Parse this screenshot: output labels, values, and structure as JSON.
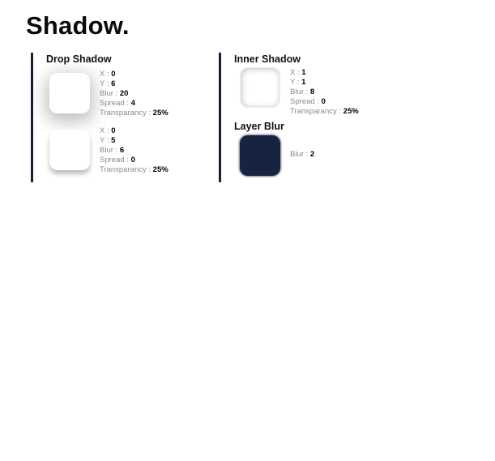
{
  "page": {
    "title": "Shadow."
  },
  "drop_shadow": {
    "title": "Drop Shadow",
    "items": [
      {
        "x_label": "X",
        "x": "0",
        "y_label": "Y",
        "y": "6",
        "blur_label": "Blur",
        "blur": "20",
        "spread_label": "Spread",
        "spread": "4",
        "transparency_label": "Transparancy",
        "transparency": "25%"
      },
      {
        "x_label": "X",
        "x": "0",
        "y_label": "Y",
        "y": "5",
        "blur_label": "Blur",
        "blur": "6",
        "spread_label": "Spread",
        "spread": "0",
        "transparency_label": "Transparancy",
        "transparency": "25%"
      }
    ]
  },
  "inner_shadow": {
    "title": "Inner Shadow",
    "x_label": "X",
    "x": "1",
    "y_label": "Y",
    "y": "1",
    "blur_label": "Blur",
    "blur": "8",
    "spread_label": "Spread",
    "spread": "0",
    "transparency_label": "Transparancy",
    "transparency": "25%"
  },
  "layer_blur": {
    "title": "Layer Blur",
    "blur_label": "Blur",
    "blur": "2",
    "swatch_color": "#172341"
  },
  "colors": {
    "accent_line": "#17203a",
    "label_gray": "#8a8a8a"
  }
}
